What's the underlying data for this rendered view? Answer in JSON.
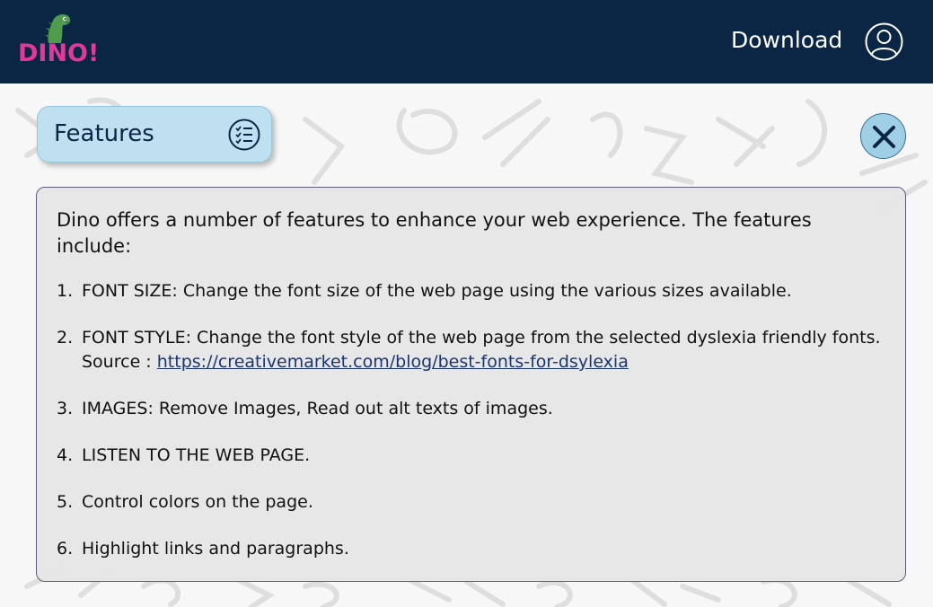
{
  "header": {
    "logo_text": "DINO!",
    "download_label": "Download",
    "brand_color": "#e0399b",
    "bg_color": "#0b2545"
  },
  "features_tab": {
    "title": "Features"
  },
  "panel": {
    "intro": "Dino offers a number of features to enhance your web experience. The features include:",
    "items": [
      {
        "num": "1.",
        "text": "FONT SIZE: Change the font size of the web page using the various sizes available."
      },
      {
        "num": "2.",
        "text": "FONT STYLE: Change the font style of the web page from the selected dyslexia friendly fonts. Source : ",
        "link": "https://creativemarket.com/blog/best-fonts-for-dsylexia"
      },
      {
        "num": "3.",
        "text": "IMAGES: Remove Images, Read out alt texts of images."
      },
      {
        "num": "4.",
        "text": "LISTEN TO THE WEB PAGE."
      },
      {
        "num": "5.",
        "text": "Control colors on the page."
      },
      {
        "num": "6.",
        "text": "Highlight links and paragraphs."
      }
    ]
  }
}
